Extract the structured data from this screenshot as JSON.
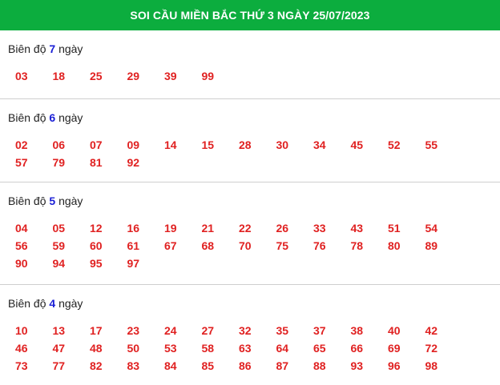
{
  "header": {
    "title": "SOI CẦU MIỀN BẮC THỨ 3 NGÀY 25/07/2023"
  },
  "label_prefix": "Biên độ",
  "label_suffix": "ngày",
  "sections": [
    {
      "id": "sec-7",
      "days": "7",
      "numbers": [
        "03",
        "18",
        "25",
        "29",
        "39",
        "99"
      ]
    },
    {
      "id": "sec-6",
      "days": "6",
      "numbers": [
        "02",
        "06",
        "07",
        "09",
        "14",
        "15",
        "28",
        "30",
        "34",
        "45",
        "52",
        "55",
        "57",
        "79",
        "81",
        "92"
      ]
    },
    {
      "id": "sec-5",
      "days": "5",
      "numbers": [
        "04",
        "05",
        "12",
        "16",
        "19",
        "21",
        "22",
        "26",
        "33",
        "43",
        "51",
        "54",
        "56",
        "59",
        "60",
        "61",
        "67",
        "68",
        "70",
        "75",
        "76",
        "78",
        "80",
        "89",
        "90",
        "94",
        "95",
        "97"
      ]
    },
    {
      "id": "sec-4",
      "days": "4",
      "numbers": [
        "10",
        "13",
        "17",
        "23",
        "24",
        "27",
        "32",
        "35",
        "37",
        "38",
        "40",
        "42",
        "46",
        "47",
        "48",
        "50",
        "53",
        "58",
        "63",
        "64",
        "65",
        "66",
        "69",
        "72",
        "73",
        "77",
        "82",
        "83",
        "84",
        "85",
        "86",
        "87",
        "88",
        "93",
        "96",
        "98"
      ]
    }
  ],
  "colors": {
    "header_bg": "#0cad3e",
    "number": "#e02121",
    "days_highlight": "#1a1fd6"
  }
}
